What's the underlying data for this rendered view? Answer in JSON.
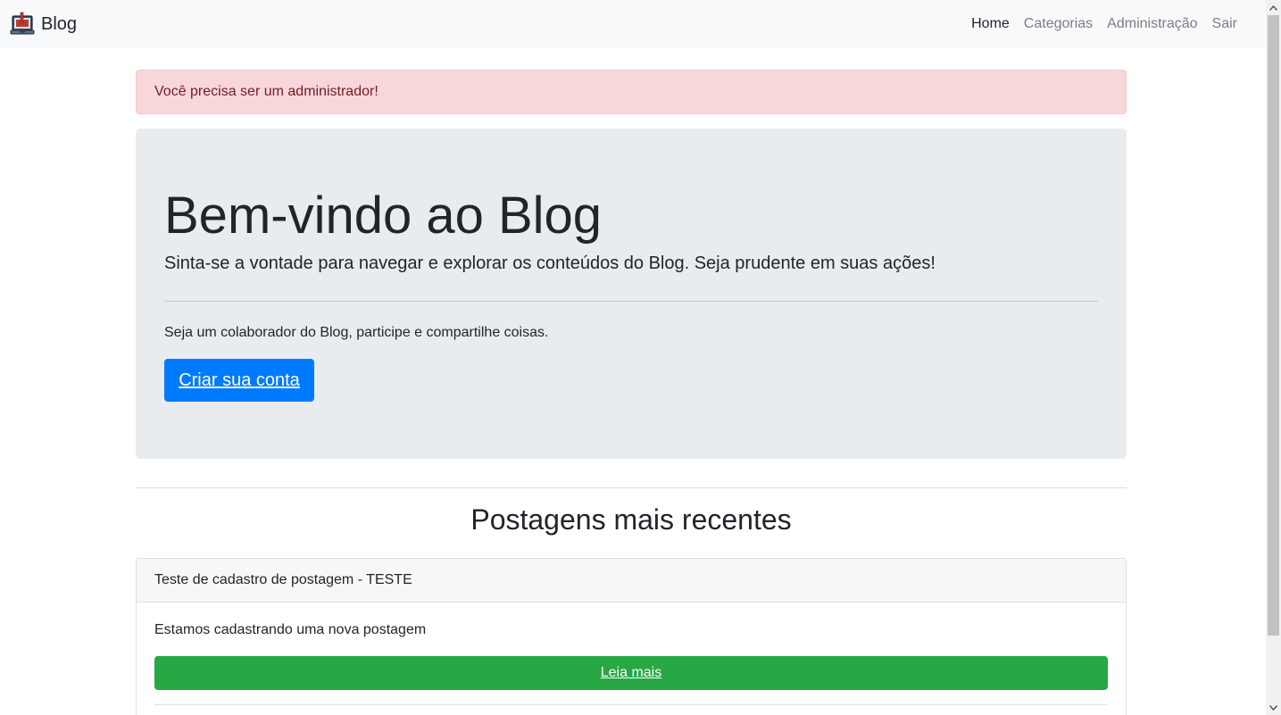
{
  "navbar": {
    "brand": "Blog",
    "logo_icon": "laptop-logo-icon",
    "links": [
      {
        "label": "Home",
        "active": true
      },
      {
        "label": "Categorias",
        "active": false
      },
      {
        "label": "Administração",
        "active": false
      },
      {
        "label": "Sair",
        "active": false
      }
    ]
  },
  "alert": {
    "message": "Você precisa ser um administrador!",
    "color": "#f8d7da"
  },
  "jumbotron": {
    "title": "Bem-vindo ao Blog",
    "lead": "Sinta-se a vontade para navegar e explorar os conteúdos do Blog. Seja prudente em suas ações!",
    "text": "Seja um colaborador do Blog, participe e compartilhe coisas.",
    "button_label": "Criar sua conta"
  },
  "recent": {
    "title": "Postagens mais recentes",
    "posts": [
      {
        "title": "Teste de cadastro de postagem - TESTE",
        "description": "Estamos cadastrando uma nova postagem",
        "button_label": "Leia mais"
      }
    ]
  },
  "colors": {
    "primary": "#007bff",
    "success": "#28a745",
    "navbar_bg": "#f8f9fa",
    "jumbotron_bg": "#e9ecef"
  }
}
